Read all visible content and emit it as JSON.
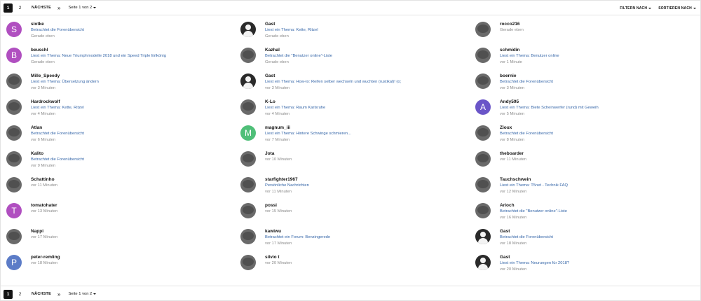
{
  "pagination": {
    "pages": [
      "1",
      "2"
    ],
    "next_label": "NÄCHSTE",
    "jump_icon": "double-chevron-right-icon",
    "page_info": "Seite 1 von 2"
  },
  "filters": {
    "filter_label": "FILTERN NACH",
    "sort_label": "SORTIEREN NACH"
  },
  "columns": [
    [
      {
        "name": "slotke",
        "activity": "Betrachtet die Forenübersicht",
        "time": "Gerade eben",
        "avatar": {
          "type": "letter",
          "letter": "S",
          "color": "#b04fc0"
        }
      },
      {
        "name": "beuschl",
        "activity": "Liest ein Thema: Neue Triumphmodelle 2018 und ein Speed Triple Erlkönig",
        "time": "Gerade eben",
        "avatar": {
          "type": "letter",
          "letter": "B",
          "color": "#b04fc0"
        }
      },
      {
        "name": "Mille_Speedy",
        "activity": "Liest ein Thema: Übersetzung ändern",
        "time": "vor 3 Minuten",
        "avatar": {
          "type": "photo"
        }
      },
      {
        "name": "Hardrockwolf",
        "activity": "Liest ein Thema: Kette, Ritzel",
        "time": "vor 4 Minuten",
        "avatar": {
          "type": "photo"
        }
      },
      {
        "name": "Atlan",
        "activity": "Betrachtet die Forenübersicht",
        "time": "vor 6 Minuten",
        "avatar": {
          "type": "photo"
        }
      },
      {
        "name": "Kalito",
        "activity": "Betrachtet die Forenübersicht",
        "time": "vor 9 Minuten",
        "avatar": {
          "type": "photo"
        }
      },
      {
        "name": "Schattinho",
        "activity": "",
        "time": "vor 11 Minuten",
        "avatar": {
          "type": "photo"
        }
      },
      {
        "name": "tomatohater",
        "activity": "",
        "time": "vor 13 Minuten",
        "avatar": {
          "type": "letter",
          "letter": "T",
          "color": "#b04fc0"
        }
      },
      {
        "name": "Nappi",
        "activity": "",
        "time": "vor 17 Minuten",
        "avatar": {
          "type": "photo"
        }
      },
      {
        "name": "peter-remling",
        "activity": "",
        "time": "vor 18 Minuten",
        "avatar": {
          "type": "letter",
          "letter": "P",
          "color": "#5c7cc7"
        }
      }
    ],
    [
      {
        "name": "Gast",
        "activity": "Liest ein Thema: Kette, Ritzel",
        "time": "Gerade eben",
        "avatar": {
          "type": "guest"
        }
      },
      {
        "name": "Kazhal",
        "activity": "Betrachtet die \"Benutzer online\"-Liste",
        "time": "Gerade eben",
        "avatar": {
          "type": "photo"
        }
      },
      {
        "name": "Gast",
        "activity": "Liest ein Thema: How-to: Reifen selber wechseln und wuchten (rustikal)! (o;",
        "time": "vor 3 Minuten",
        "avatar": {
          "type": "guest"
        }
      },
      {
        "name": "K-Lo",
        "activity": "Liest ein Thema: Raum Karlsruhe",
        "time": "vor 4 Minuten",
        "avatar": {
          "type": "photo"
        }
      },
      {
        "name": "magnum_iii",
        "activity": "Liest ein Thema: Hintere Schwinge schmieren...",
        "time": "vor 7 Minuten",
        "avatar": {
          "type": "letter",
          "letter": "M",
          "color": "#4fbf78"
        }
      },
      {
        "name": "Jota",
        "activity": "",
        "time": "vor 10 Minuten",
        "avatar": {
          "type": "photo"
        }
      },
      {
        "name": "starfighter1967",
        "activity": "Persönliche Nachrichten",
        "time": "vor 11 Minuten",
        "avatar": {
          "type": "photo"
        }
      },
      {
        "name": "possi",
        "activity": "",
        "time": "vor 15 Minuten",
        "avatar": {
          "type": "photo"
        }
      },
      {
        "name": "kawiwu",
        "activity": "Betrachtet ein Forum: Benzingerede",
        "time": "vor 17 Minuten",
        "avatar": {
          "type": "photo"
        }
      },
      {
        "name": "silvio t",
        "activity": "",
        "time": "vor 20 Minuten",
        "avatar": {
          "type": "photo"
        }
      }
    ],
    [
      {
        "name": "rocco216",
        "activity": "",
        "time": "Gerade eben",
        "avatar": {
          "type": "photo"
        }
      },
      {
        "name": "schmidin",
        "activity": "Liest ein Thema: Benutzer online",
        "time": "vor 1 Minute",
        "avatar": {
          "type": "photo"
        }
      },
      {
        "name": "boernie",
        "activity": "Betrachtet die Forenübersicht",
        "time": "vor 3 Minuten",
        "avatar": {
          "type": "photo"
        }
      },
      {
        "name": "Andy595",
        "activity": "Liest ein Thema: Biete Scheinwerfer (rund) mit Geweih",
        "time": "vor 5 Minuten",
        "avatar": {
          "type": "letter",
          "letter": "A",
          "color": "#6a55c8"
        }
      },
      {
        "name": "Ziоux",
        "activity": "Betrachtet die Forenübersicht",
        "time": "vor 8 Minuten",
        "avatar": {
          "type": "photo"
        }
      },
      {
        "name": "theboarder",
        "activity": "",
        "time": "vor 11 Minuten",
        "avatar": {
          "type": "photo"
        }
      },
      {
        "name": "Tauchschwein",
        "activity": "Liest ein Thema: T5net - Technik FAQ",
        "time": "vor 12 Minuten",
        "avatar": {
          "type": "photo"
        }
      },
      {
        "name": "Arioch",
        "activity": "Betrachtet die \"Benutzer online\"-Liste",
        "time": "vor 16 Minuten",
        "avatar": {
          "type": "photo"
        }
      },
      {
        "name": "Gast",
        "activity": "Betrachtet die Forenübersicht",
        "time": "vor 18 Minuten",
        "avatar": {
          "type": "guest"
        }
      },
      {
        "name": "Gast",
        "activity": "Liest ein Thema: Neurungen für 2018?",
        "time": "vor 20 Minuten",
        "avatar": {
          "type": "guest"
        }
      }
    ]
  ]
}
